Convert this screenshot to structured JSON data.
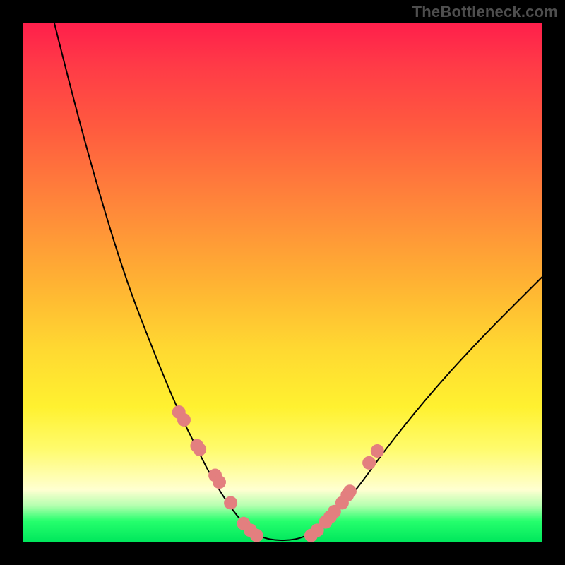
{
  "watermark": "TheBottleneck.com",
  "colors": {
    "frame": "#000000",
    "curve": "#000000",
    "marker": "#e37f7f",
    "gradient_top": "#ff1f4b",
    "gradient_bottom": "#00e75c"
  },
  "chart_data": {
    "type": "line",
    "title": "",
    "xlabel": "",
    "ylabel": "",
    "xlim": [
      0,
      1
    ],
    "ylim": [
      0,
      1
    ],
    "axes_visible": false,
    "grid": false,
    "note": "No axis ticks or numeric labels are rendered; values are normalized estimates from pixel positions.",
    "series": [
      {
        "name": "curve",
        "role": "line",
        "x": [
          0.06,
          0.1,
          0.15,
          0.2,
          0.25,
          0.3,
          0.33,
          0.36,
          0.39,
          0.42,
          0.45,
          0.5,
          0.55,
          0.6,
          0.65,
          0.7,
          0.78,
          0.88,
          1.0
        ],
        "y": [
          1.0,
          0.84,
          0.66,
          0.5,
          0.37,
          0.25,
          0.19,
          0.13,
          0.08,
          0.04,
          0.01,
          0.0,
          0.01,
          0.05,
          0.11,
          0.18,
          0.28,
          0.39,
          0.51
        ]
      },
      {
        "name": "markers",
        "role": "scatter",
        "x": [
          0.3,
          0.31,
          0.335,
          0.34,
          0.37,
          0.378,
          0.4,
          0.425,
          0.438,
          0.45,
          0.555,
          0.567,
          0.583,
          0.592,
          0.6,
          0.615,
          0.625,
          0.63,
          0.667,
          0.683
        ],
        "y": [
          0.25,
          0.235,
          0.185,
          0.178,
          0.128,
          0.115,
          0.075,
          0.035,
          0.022,
          0.012,
          0.012,
          0.022,
          0.038,
          0.048,
          0.058,
          0.075,
          0.09,
          0.097,
          0.152,
          0.175
        ]
      }
    ]
  }
}
